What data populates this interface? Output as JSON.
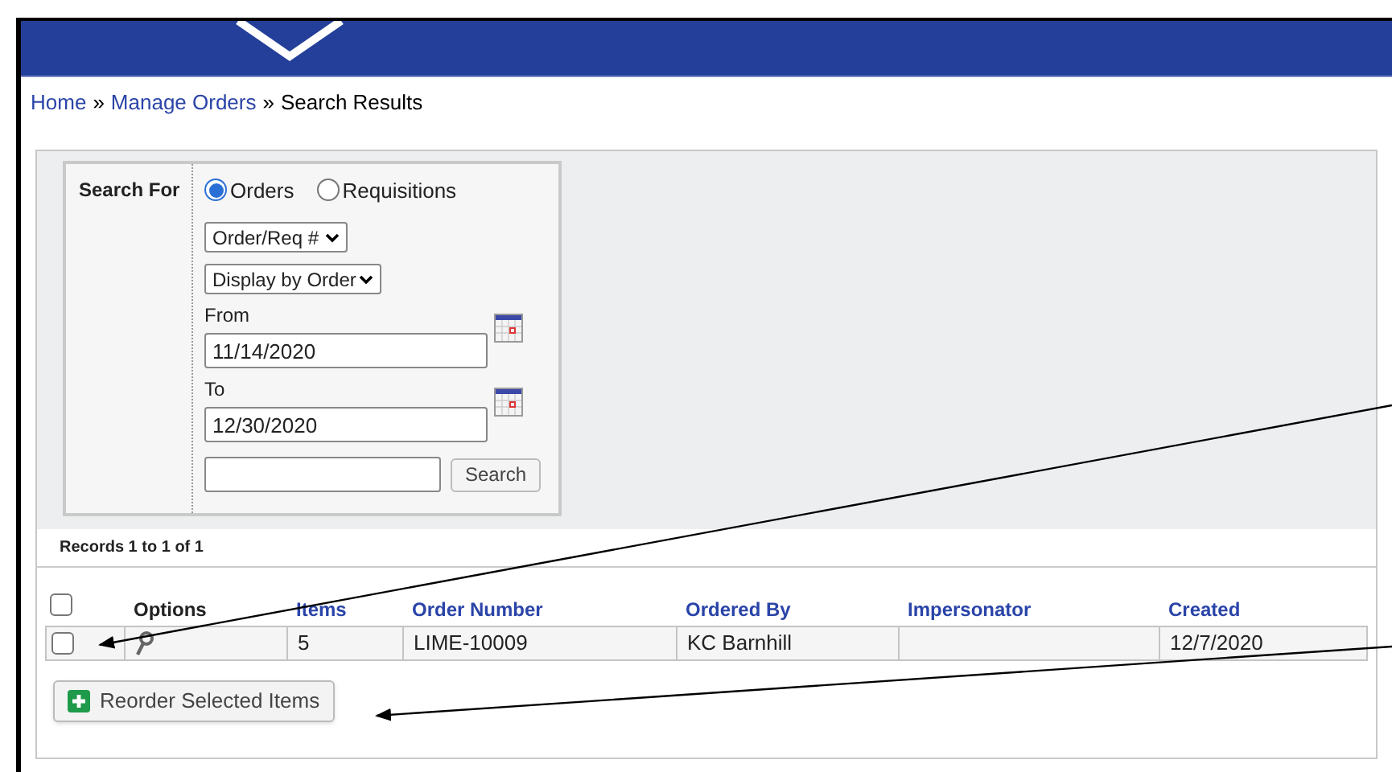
{
  "breadcrumb": [
    {
      "label": "Home",
      "kind": "link"
    },
    {
      "label": "»",
      "kind": "separator"
    },
    {
      "label": "Manage Orders",
      "kind": "link"
    },
    {
      "label": "»",
      "kind": "separator"
    },
    {
      "label": "Search Results",
      "kind": "current"
    }
  ],
  "search": {
    "label": "Search For",
    "options": [
      {
        "label": "Orders",
        "selected": true
      },
      {
        "label": "Requisitions",
        "selected": false
      }
    ],
    "field_select": "Order/Req #",
    "display_select": "Display by Order",
    "from": {
      "label": "From",
      "value": "11/14/2020"
    },
    "to": {
      "label": "To",
      "value": "12/30/2020"
    },
    "button": "Search"
  },
  "records": "Records 1 to 1 of 1",
  "table": {
    "select_all_checked": false,
    "columns": [
      {
        "label": "Options",
        "kind": "plain"
      },
      {
        "label": "Items",
        "kind": "link"
      },
      {
        "label": "Order Number",
        "kind": "link"
      },
      {
        "label": "Ordered By",
        "kind": "link"
      },
      {
        "label": "Impersonator",
        "kind": "link"
      },
      {
        "label": "Created",
        "kind": "link"
      }
    ],
    "rows": [
      {
        "checked": false,
        "items": "5",
        "order_number": "LIME-10009",
        "ordered_by": "KC Barnhill",
        "created": "12/7/2020"
      }
    ]
  },
  "reorder_button": "Reorder Selected Items"
}
